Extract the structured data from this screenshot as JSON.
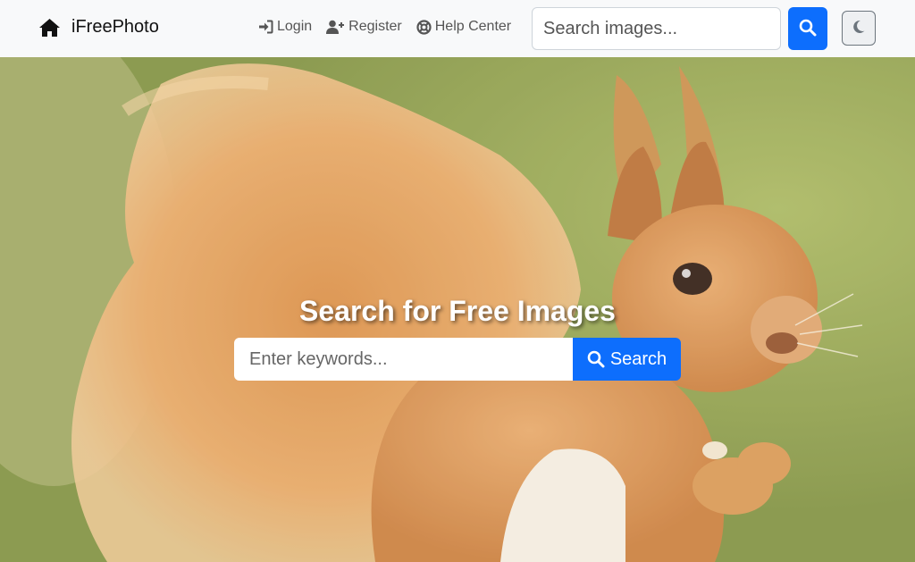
{
  "navbar": {
    "brand": {
      "icon": "home-icon",
      "label": "iFreePhoto"
    },
    "links": [
      {
        "label": "Login",
        "icon": "login-icon"
      },
      {
        "label": "Register",
        "icon": "user-plus-icon"
      },
      {
        "label": "Help Center",
        "icon": "lifebuoy-icon"
      }
    ],
    "search": {
      "placeholder": "Search images...",
      "button_icon": "search-icon"
    },
    "theme_toggle_icon": "moon-icon"
  },
  "hero": {
    "title": "Search for Free Images",
    "search_placeholder": "Enter keywords...",
    "search_button_label": "Search",
    "background": "squirrel-photo"
  },
  "colors": {
    "primary": "#0d6efd",
    "navbar_bg": "#f8f9fa",
    "link": "#555555"
  }
}
